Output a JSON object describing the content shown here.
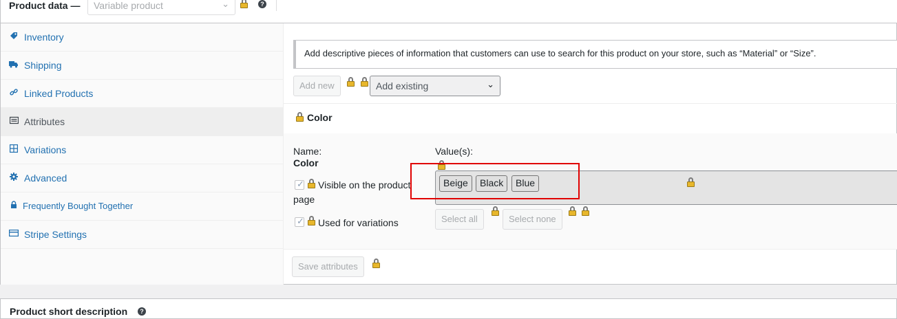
{
  "header": {
    "title": "Product data —",
    "product_type_value": "Variable product",
    "product_type_chevron_icon": "chevron-down-icon",
    "help_icon": "question-icon"
  },
  "sidebar": {
    "items": [
      {
        "label": "Inventory",
        "icon": "tag-icon"
      },
      {
        "label": "Shipping",
        "icon": "truck-icon"
      },
      {
        "label": "Linked Products",
        "icon": "link-icon"
      },
      {
        "label": "Attributes",
        "icon": "list-icon",
        "active": true
      },
      {
        "label": "Variations",
        "icon": "grid-icon"
      },
      {
        "label": "Advanced",
        "icon": "gear-icon"
      },
      {
        "label": "Frequently Bought Together",
        "icon": "lock-icon"
      },
      {
        "label": "Stripe Settings",
        "icon": "card-icon"
      }
    ]
  },
  "attributes": {
    "notice": "Add descriptive pieces of information that customers can use to search for this product on your store, such as “Material” or “Size”.",
    "add_new_label": "Add new",
    "add_existing_label": "Add existing",
    "attribute": {
      "header_name": "Color",
      "name_label": "Name:",
      "name_value": "Color",
      "values_label": "Value(s):",
      "values": [
        "Beige",
        "Black",
        "Blue"
      ],
      "visible_label": "Visible on the product",
      "visible_label_cont": "page",
      "visible_checked": true,
      "variations_label": "Used for variations",
      "variations_checked": true,
      "select_all_label": "Select all",
      "select_none_label": "Select none"
    },
    "save_label": "Save attributes"
  },
  "short_description": {
    "title": "Product short description"
  },
  "colors": {
    "link": "#2271b1",
    "highlight_border": "#e00000",
    "lock": "#e8b72c"
  }
}
